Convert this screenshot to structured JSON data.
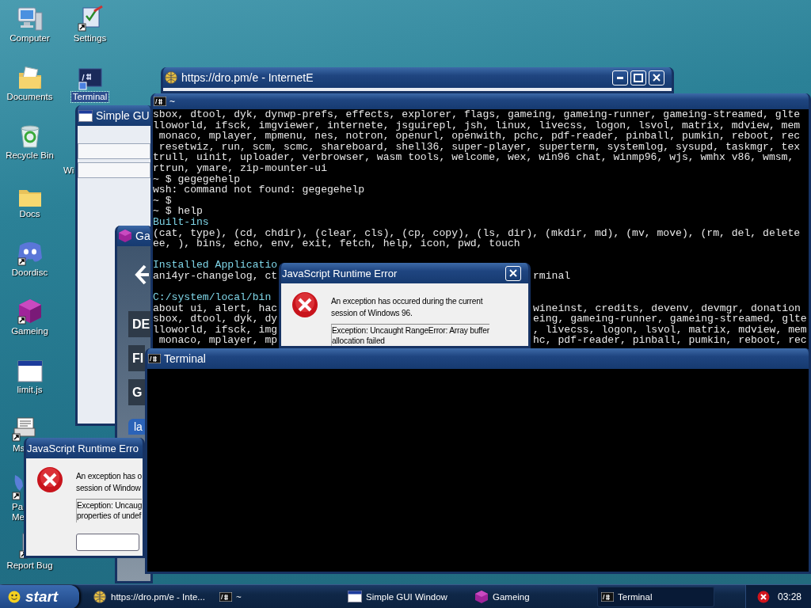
{
  "desktop_icons": [
    {
      "label": "Computer",
      "kind": "computer",
      "selected": false
    },
    {
      "label": "Documents",
      "kind": "documents",
      "selected": false
    },
    {
      "label": "Recycle Bin",
      "kind": "recycle",
      "selected": false
    },
    {
      "label": "Docs",
      "kind": "folder",
      "selected": false
    },
    {
      "label": "Doordisc",
      "kind": "chat",
      "selected": false
    },
    {
      "label": "Gameing",
      "kind": "cube",
      "selected": false
    },
    {
      "label": "limit.js",
      "kind": "window",
      "selected": false
    },
    {
      "label": "Ms",
      "kind": "printer",
      "selected": false
    },
    {
      "label": "Pa Me",
      "kind": "palette",
      "selected": false
    },
    {
      "label": "Report Bug",
      "kind": "document",
      "selected": false
    },
    {
      "label": "Settings",
      "kind": "settings",
      "selected": false
    },
    {
      "label": "Terminal",
      "kind": "terminal",
      "selected": true
    },
    {
      "label": "Wi",
      "kind": "hidden",
      "selected": false
    }
  ],
  "windows": [
    {
      "kind": "gui",
      "title": "Simple GU"
    },
    {
      "kind": "game",
      "title": "Ga",
      "buttons": [
        "DE",
        "FI",
        "G"
      ],
      "tab": "la"
    },
    {
      "kind": "browser",
      "title": "https://dro.pm/e - InternetE"
    },
    {
      "kind": "terminal_log",
      "title": "~",
      "lines": [
        {
          "kind": "out",
          "text": "sbox, dtool, dyk, dynwp-prefs, effects, explorer, flags, gameing, gameing-runner, gameing-streamed, glte"
        },
        {
          "kind": "out",
          "text": "lloworld, ifsck, imgviewer, internete, jsguirepl, jsh, linux, livecss, logon, lsvol, matrix, mdview, mem"
        },
        {
          "kind": "out",
          "text": " monaco, mplayer, mpmenu, nes, notron, openurl, openwith, pchc, pdf-reader, pinball, pumkin, reboot, rec"
        },
        {
          "kind": "out",
          "text": " resetwiz, run, scm, scmc, shareboard, shell36, super-player, superterm, systemlog, sysupd, taskmgr, tex"
        },
        {
          "kind": "out",
          "text": "trull, uinit, uploader, verbrowser, wasm tools, welcome, wex, win96 chat, winmp96, wjs, wmhx v86, wmsm,"
        },
        {
          "kind": "out",
          "text": "rtrun, ymare, zip-mounter-ui"
        },
        {
          "kind": "out",
          "text": "~ $ gegegehelp"
        },
        {
          "kind": "out",
          "text": "wsh: command not found: gegegehelp"
        },
        {
          "kind": "out",
          "text": "~ $"
        },
        {
          "kind": "out",
          "text": "~ $ help"
        },
        {
          "kind": "heading",
          "text": "Built-ins"
        },
        {
          "kind": "out",
          "text": "(cat, type), (cd, chdir), (clear, cls), (cp, copy), (ls, dir), (mkdir, md), (mv, move), (rm, del, delete"
        },
        {
          "kind": "out",
          "text": "ee, ), bins, echo, env, exit, fetch, help, icon, pwd, touch"
        },
        {
          "kind": "blank"
        },
        {
          "kind": "heading",
          "text": "Installed Applicatio"
        },
        {
          "kind": "out",
          "text": "ani4yr-changelog, ct",
          "tail": "rminal"
        },
        {
          "kind": "blank"
        },
        {
          "kind": "heading",
          "text": "C:/system/local/bin"
        },
        {
          "kind": "out",
          "text": "about ui, alert, hac",
          "tail": "wineinst, credits, devenv, devmgr, donation"
        },
        {
          "kind": "out",
          "text": "sbox, dtool, dyk, dy",
          "tail": "eing, gameing-runner, gameing-streamed, glte"
        },
        {
          "kind": "out",
          "text": "lloworld, ifsck, img",
          "tail": ", livecss, logon, lsvol, matrix, mdview, mem"
        },
        {
          "kind": "out",
          "text": " monaco, mplayer, mp",
          "tail": "hc, pdf-reader, pinball, pumkin, reboot, rec"
        }
      ]
    },
    {
      "kind": "error",
      "title": "JavaScript Runtime Error",
      "close_button": true,
      "message": [
        "An exception has occured during the current",
        "session of Windows 96."
      ],
      "detail": [
        "Exception: Uncaught RangeError: Array buffer",
        "allocation failed"
      ]
    },
    {
      "kind": "error",
      "title": "JavaScript Runtime Erro",
      "message": [
        "An exception has o",
        "session of Window"
      ],
      "detail": [
        "Exception: Uncaug",
        "properties of undef"
      ],
      "ok_button": true
    },
    {
      "kind": "terminal",
      "title": "Terminal"
    }
  ],
  "taskbar": {
    "start": "start",
    "items": [
      {
        "label": "https://dro.pm/e - Inte...",
        "kind": "browser",
        "selected": false
      },
      {
        "label": "~",
        "kind": "terminal",
        "selected": false
      },
      {
        "label": "Simple GUI Window",
        "kind": "window",
        "selected": false
      },
      {
        "label": "Gameing",
        "kind": "cube",
        "selected": false
      },
      {
        "label": "Terminal",
        "kind": "terminal",
        "selected": true
      }
    ],
    "clock": "03:28"
  }
}
